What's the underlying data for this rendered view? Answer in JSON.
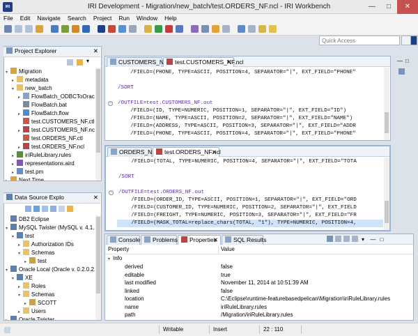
{
  "window": {
    "title": "IRI Development - Migration/new_batch/test.ORDERS_NF.ncl - IRI Workbench",
    "app_icon_text": "IRI"
  },
  "menu": [
    "File",
    "Edit",
    "Navigate",
    "Search",
    "Project",
    "Run",
    "Window",
    "Help"
  ],
  "toolbar": {
    "quick_access_placeholder": "Quick Access"
  },
  "explorer": {
    "title": "Project Explorer",
    "items": [
      {
        "label": "Migration",
        "level": 0,
        "icon": "project-folder-icon",
        "twisty": "▾"
      },
      {
        "label": "metadata",
        "level": 1,
        "icon": "folder-icon",
        "twisty": "▸"
      },
      {
        "label": "new_batch",
        "level": 1,
        "icon": "folder-icon",
        "twisty": "▾"
      },
      {
        "label": "FlowBatch_ODBCToOracle",
        "level": 2,
        "icon": "file-icon",
        "twisty": "▸"
      },
      {
        "label": "FlowBatch.bat",
        "level": 2,
        "icon": "bat-file-icon",
        "twisty": ""
      },
      {
        "label": "FlowBatch.flow",
        "level": 2,
        "icon": "flow-file-icon",
        "twisty": "▸"
      },
      {
        "label": "test.CUSTOMERS_NF.ctl",
        "level": 2,
        "icon": "ctl-file-icon",
        "twisty": ""
      },
      {
        "label": "test.CUSTOMERS_NF.ncl",
        "level": 2,
        "icon": "ncl-file-icon",
        "twisty": "▸"
      },
      {
        "label": "test.ORDERS_NF.ctl",
        "level": 2,
        "icon": "ctl-file-icon",
        "twisty": ""
      },
      {
        "label": "test.ORDERS_NF.ncl",
        "level": 2,
        "icon": "ncl-file-icon",
        "twisty": "▸"
      },
      {
        "label": "iriRuleLibrary.rules",
        "level": 1,
        "icon": "rules-file-icon",
        "twisty": "▸"
      },
      {
        "label": "representations.aird",
        "level": 1,
        "icon": "aird-file-icon",
        "twisty": "▸"
      },
      {
        "label": "test.pm",
        "level": 1,
        "icon": "pm-file-icon",
        "twisty": "▸"
      },
      {
        "label": "Next Time",
        "level": 0,
        "icon": "project-folder-icon",
        "twisty": "▸"
      },
      {
        "label": "Testing",
        "level": 0,
        "icon": "project-folder-icon",
        "twisty": "▸"
      }
    ]
  },
  "datasource": {
    "title": "Data Source Explo",
    "items": [
      {
        "label": "DB2 Eclipse",
        "level": 0,
        "icon": "database-icon",
        "twisty": ""
      },
      {
        "label": "MySQL Twister (MySQL v. 4.1.2",
        "level": 0,
        "icon": "database-icon",
        "twisty": "▾"
      },
      {
        "label": "test",
        "level": 1,
        "icon": "database-icon",
        "twisty": "▾"
      },
      {
        "label": "Authorization IDs",
        "level": 2,
        "icon": "folder-icon",
        "twisty": "▸"
      },
      {
        "label": "Schemas",
        "level": 2,
        "icon": "folder-icon",
        "twisty": "▾"
      },
      {
        "label": "test",
        "level": 3,
        "icon": "schema-icon",
        "twisty": "▸"
      },
      {
        "label": "Oracle Local (Oracle v. 0.2.0.2.0",
        "level": 0,
        "icon": "database-icon",
        "twisty": "▾"
      },
      {
        "label": "XE",
        "level": 1,
        "icon": "database-icon",
        "twisty": "▾"
      },
      {
        "label": "Roles",
        "level": 2,
        "icon": "folder-icon",
        "twisty": "▸"
      },
      {
        "label": "Schemas",
        "level": 2,
        "icon": "folder-icon",
        "twisty": "▾"
      },
      {
        "label": "SCOTT",
        "level": 3,
        "icon": "schema-icon",
        "twisty": "▸"
      },
      {
        "label": "Users",
        "level": 2,
        "icon": "folder-icon",
        "twisty": "▸"
      },
      {
        "label": "Oracle Twister",
        "level": 0,
        "icon": "database-icon",
        "twisty": "▸"
      }
    ]
  },
  "editor1": {
    "tabs": [
      {
        "label": "CUSTOMERS_NF",
        "active": false
      },
      {
        "label": "test.CUSTOMERS_NF.ncl",
        "active": true,
        "closable": true
      }
    ],
    "lines": [
      {
        "text": "    /FIELD=(PHONE, TYPE=ASCII, POSITION=4, SEPARATOR=\"|\", EXT_FIELD=\"PHONE\""
      },
      {
        "text": ""
      },
      {
        "text": "/SORT"
      },
      {
        "text": ""
      },
      {
        "text": "/OUTFILE=test.CUSTOMERS_NF.out",
        "fold": true
      },
      {
        "text": "    /FIELD=(ID, TYPE=NUMERIC, POSITION=1, SEPARATOR=\"|\", EXT_FIELD=\"ID\")"
      },
      {
        "text": "    /FIELD=(NAME, TYPE=ASCII, POSITION=2, SEPARATOR=\"|\", EXT_FIELD=\"NAME\")"
      },
      {
        "text": "    /FIELD=(ADDRESS, TYPE=ASCII, POSITION=3, SEPARATOR=\"|\", EXT_FIELD=\"ADDR"
      },
      {
        "text": "    /FIELD=(PHONE, TYPE=ASCII, POSITION=4, SEPARATOR=\"|\", EXT_FIELD=\"PHONE\""
      }
    ]
  },
  "editor2": {
    "tabs": [
      {
        "label": "ORDERS_NF",
        "active": false
      },
      {
        "label": "test.ORDERS_NF.ncl",
        "active": true,
        "closable": true
      }
    ],
    "lines": [
      {
        "text": "    /FIELD=(TOTAL, TYPE=NUMERIC, POSITION=4, SEPARATOR=\"|\", EXT_FIELD=\"TOTA"
      },
      {
        "text": ""
      },
      {
        "text": "/SORT"
      },
      {
        "text": ""
      },
      {
        "text": "/OUTFILE=test.ORDERS_NF.out",
        "fold": true
      },
      {
        "text": "    /FIELD=(ORDER_ID, TYPE=ASCII, POSITION=1, SEPARATOR=\"|\", EXT_FIELD=\"ORD"
      },
      {
        "text": "    /FIELD=(CUSTOMER_ID, TYPE=NUMERIC, POSITION=2, SEPARATOR=\"|\", EXT_FIELD"
      },
      {
        "text": "    /FIELD=(FREIGHT, TYPE=NUMERIC, POSITION=3, SEPARATOR=\"|\", EXT_FIELD=\"FR"
      },
      {
        "text": "    /FIELD=(MASK_TOTAL=replace_chars(TOTAL, \"1\"), TYPE=NUMERIC, POSITION=4,",
        "selected": true
      }
    ]
  },
  "bottom": {
    "tabs": [
      {
        "label": "Console",
        "active": false
      },
      {
        "label": "Problems",
        "active": false
      },
      {
        "label": "Properties",
        "active": true,
        "closable": true
      },
      {
        "label": "SQL Results",
        "active": false
      }
    ],
    "columns": [
      "Property",
      "Value"
    ],
    "group": "Info",
    "rows": [
      {
        "property": "derived",
        "value": "false"
      },
      {
        "property": "editable",
        "value": "true"
      },
      {
        "property": "last modified",
        "value": "November 11, 2014 at 10:51:39 AM"
      },
      {
        "property": "linked",
        "value": "false"
      },
      {
        "property": "location",
        "value": "C:\\Eclipse\\runtime-featurebasedpelican\\Migration\\iriRuleLibrary.rules"
      },
      {
        "property": "name",
        "value": "iriRuleLibrary.rules"
      },
      {
        "property": "path",
        "value": "/Migration/iriRuleLibrary.rules"
      }
    ]
  },
  "status": {
    "writable": "Writable",
    "insert": "Insert",
    "position": "22 : 110"
  },
  "colors": {
    "selection": "#cfe2fb",
    "line_highlight": "#e8f2fe",
    "accent": "#1e3f86"
  }
}
